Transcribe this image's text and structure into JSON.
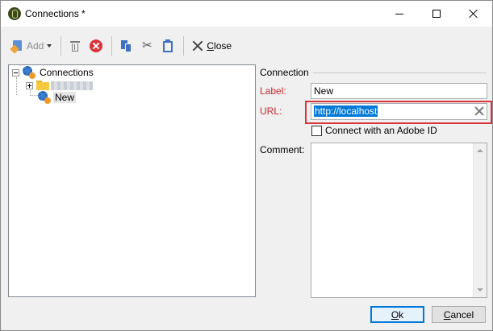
{
  "window": {
    "title": "Connections *"
  },
  "toolbar": {
    "add_label": "Add",
    "close_label_underlined": "C",
    "close_label_rest": "lose"
  },
  "tree": {
    "root_label": "Connections",
    "selected_label": "New"
  },
  "form": {
    "section_title": "Connection",
    "label_field_label": "Label:",
    "label_value": "New",
    "url_field_label": "URL:",
    "url_value": "http://localhost",
    "adobe_id_checkbox_label": "Connect with an Adobe ID",
    "adobe_id_checked": false,
    "comment_field_label": "Comment:",
    "comment_value": ""
  },
  "buttons": {
    "ok_underlined": "O",
    "ok_rest": "k",
    "cancel_underlined": "C",
    "cancel_rest": "ancel"
  },
  "colors": {
    "mandatory_label": "#c8262e",
    "highlight_frame": "#d7363c",
    "selection": "#0078d7"
  }
}
